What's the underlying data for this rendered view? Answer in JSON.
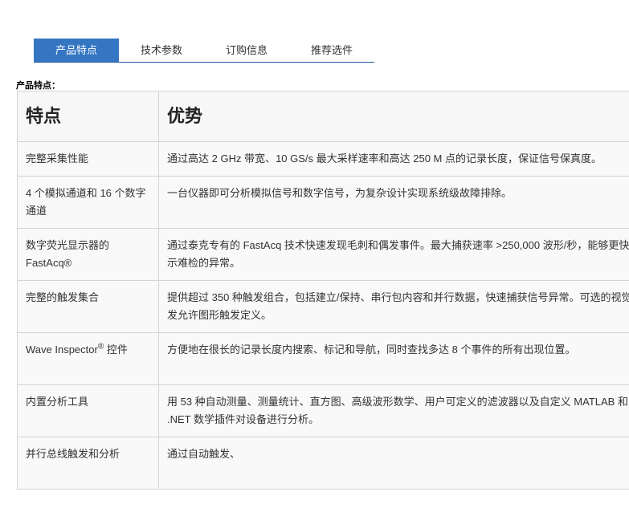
{
  "tabs": [
    {
      "label": "产品特点",
      "active": true
    },
    {
      "label": "技术参数",
      "active": false
    },
    {
      "label": "订购信息",
      "active": false
    },
    {
      "label": "推荐选件",
      "active": false
    }
  ],
  "section_title": "产品特点：",
  "table": {
    "headers": [
      "特点",
      "优势"
    ],
    "rows": [
      {
        "feature": "完整采集性能",
        "benefit": "通过高达 2 GHz 带宽、10 GS/s 最大采样速率和高达 250 M 点的记录长度，保证信号保真度。"
      },
      {
        "feature": "4 个模拟通道和 16 个数字通道",
        "benefit": "一台仪器即可分析模拟信号和数字信号，为复杂设计实现系统级故障排除。"
      },
      {
        "feature": "数字荧光显示器的 FastAcq®",
        "benefit": "通过泰克专有的 FastAcq 技术快速发现毛刺和偶发事件。最大捕获速率 >250,000 波形/秒，能够更快地显示难检的异常。"
      },
      {
        "feature": "完整的触发集合",
        "benefit": "提供超过 350 种触发组合，包括建立/保持、串行包内容和并行数据，快速捕获信号异常。可选的视觉触发允许图形触发定义。"
      },
      {
        "feature_main": "Wave Inspector",
        "feature_sup": "®",
        "feature_tail": " 控件",
        "benefit": "方便地在很长的记录长度内搜索、标记和导航，同时查找多达 8 个事件的所有出现位置。"
      },
      {
        "feature": "内置分析工具",
        "benefit": "用 53 种自动测量、测量统计、直方图、高级波形数学、用户可定义的滤波器以及自定义 MATLAB 和 .NET 数学插件对设备进行分析。"
      },
      {
        "feature": "并行总线触发和分析",
        "benefit": "通过自动触发、"
      }
    ]
  }
}
